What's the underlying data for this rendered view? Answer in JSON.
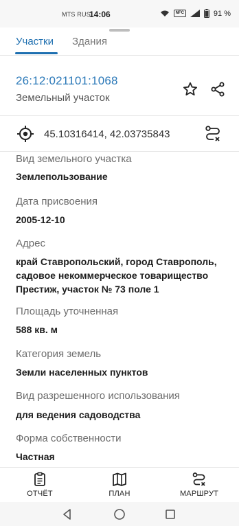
{
  "status_bar": {
    "carrier": "MTS RUS",
    "time": "14:06",
    "nfc": "NFC",
    "battery": "91 %"
  },
  "tabs": [
    {
      "label": "Участки",
      "active": true
    },
    {
      "label": "Здания",
      "active": false
    }
  ],
  "parcel": {
    "cadastral_number": "26:12:021101:1068",
    "object_type": "Земельный участок"
  },
  "coordinates": {
    "text": "45.10316414, 42.03735843"
  },
  "fields": [
    {
      "label": "Вид земельного участка",
      "value": "Землепользование"
    },
    {
      "label": "Дата присвоения",
      "value": "2005-12-10"
    },
    {
      "label": "Адрес",
      "value": "край Ставропольский, город Ставрополь, садовое некоммерческое товарищество Престиж, участок № 73 поле 1"
    },
    {
      "label": "Площадь уточненная",
      "value": "588 кв. м"
    },
    {
      "label": "Категория земель",
      "value": "Земли населенных пунктов"
    },
    {
      "label": "Вид разрешенного использования",
      "value": "для ведения садоводства"
    },
    {
      "label": "Форма собственности",
      "value": "Частная"
    }
  ],
  "bottom_nav": [
    {
      "label": "ОТЧЁТ",
      "icon": "report-icon"
    },
    {
      "label": "ПЛАН",
      "icon": "map-icon"
    },
    {
      "label": "МАРШРУТ",
      "icon": "route-icon"
    }
  ],
  "colors": {
    "accent": "#1e6fb0",
    "cadastral_number": "#2a78b8"
  }
}
